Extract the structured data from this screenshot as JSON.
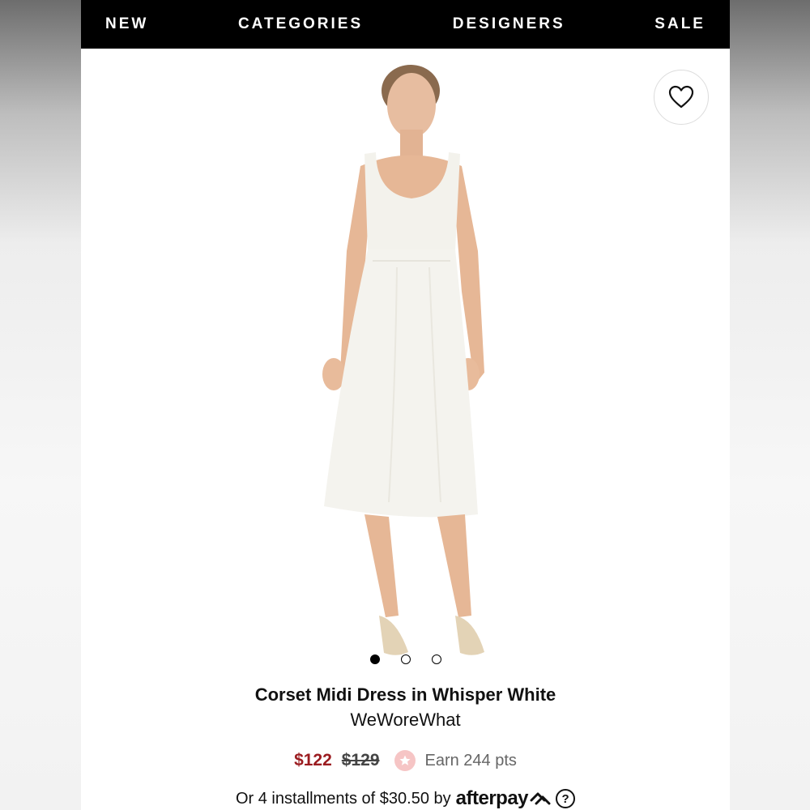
{
  "nav": {
    "items": [
      {
        "label": "NEW"
      },
      {
        "label": "CATEGORIES"
      },
      {
        "label": "DESIGNERS"
      },
      {
        "label": "SALE"
      }
    ]
  },
  "gallery": {
    "current_index": 1,
    "dot_count": 3,
    "wishlist_icon": "heart-icon"
  },
  "product": {
    "title": "Corset Midi Dress in Whisper White",
    "brand": "WeWoreWhat",
    "sale_price": "$122",
    "original_price": "$129",
    "points": "Earn 244 pts",
    "installments": "Or 4 installments of $30.50 by",
    "afterpay_label": "afterpay",
    "help_label": "?"
  },
  "colors": {
    "sale": "#9b1c20",
    "nav_bg": "#000000",
    "points_icon_bg": "#f6c5c5"
  }
}
